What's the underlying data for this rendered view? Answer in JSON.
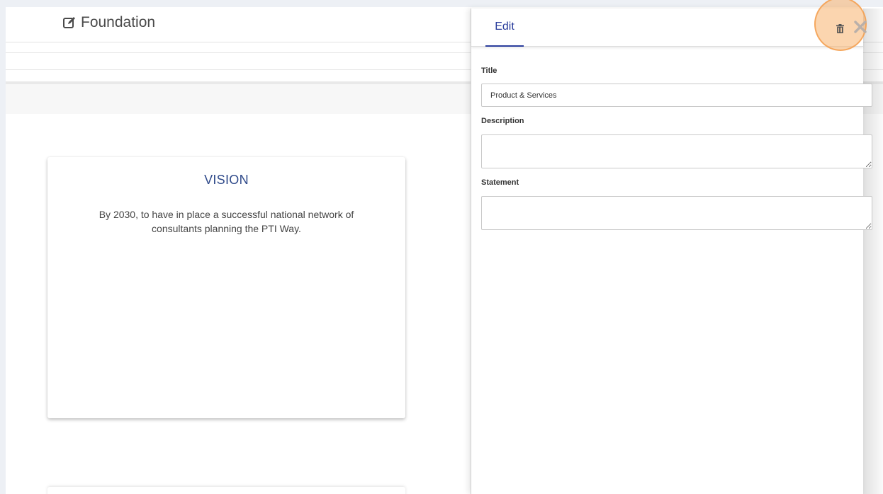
{
  "page": {
    "title": "Foundation",
    "title_icon": "edit-icon"
  },
  "vision_card": {
    "title": "VISION",
    "text": "By 2030, to have in place a successful national network of consultants planning the PTI Way."
  },
  "edit_panel": {
    "tab_label": "Edit",
    "trash_icon": "trash-icon",
    "close_icon": "close-icon",
    "highlight_color": "#f8b26e",
    "fields": {
      "title_label": "Title",
      "title_value": "Product & Services",
      "description_label": "Description",
      "description_value": "",
      "statement_label": "Statement",
      "statement_value": ""
    }
  },
  "colors": {
    "accent": "#2a3d9c",
    "card_title": "#2f4a8a"
  }
}
